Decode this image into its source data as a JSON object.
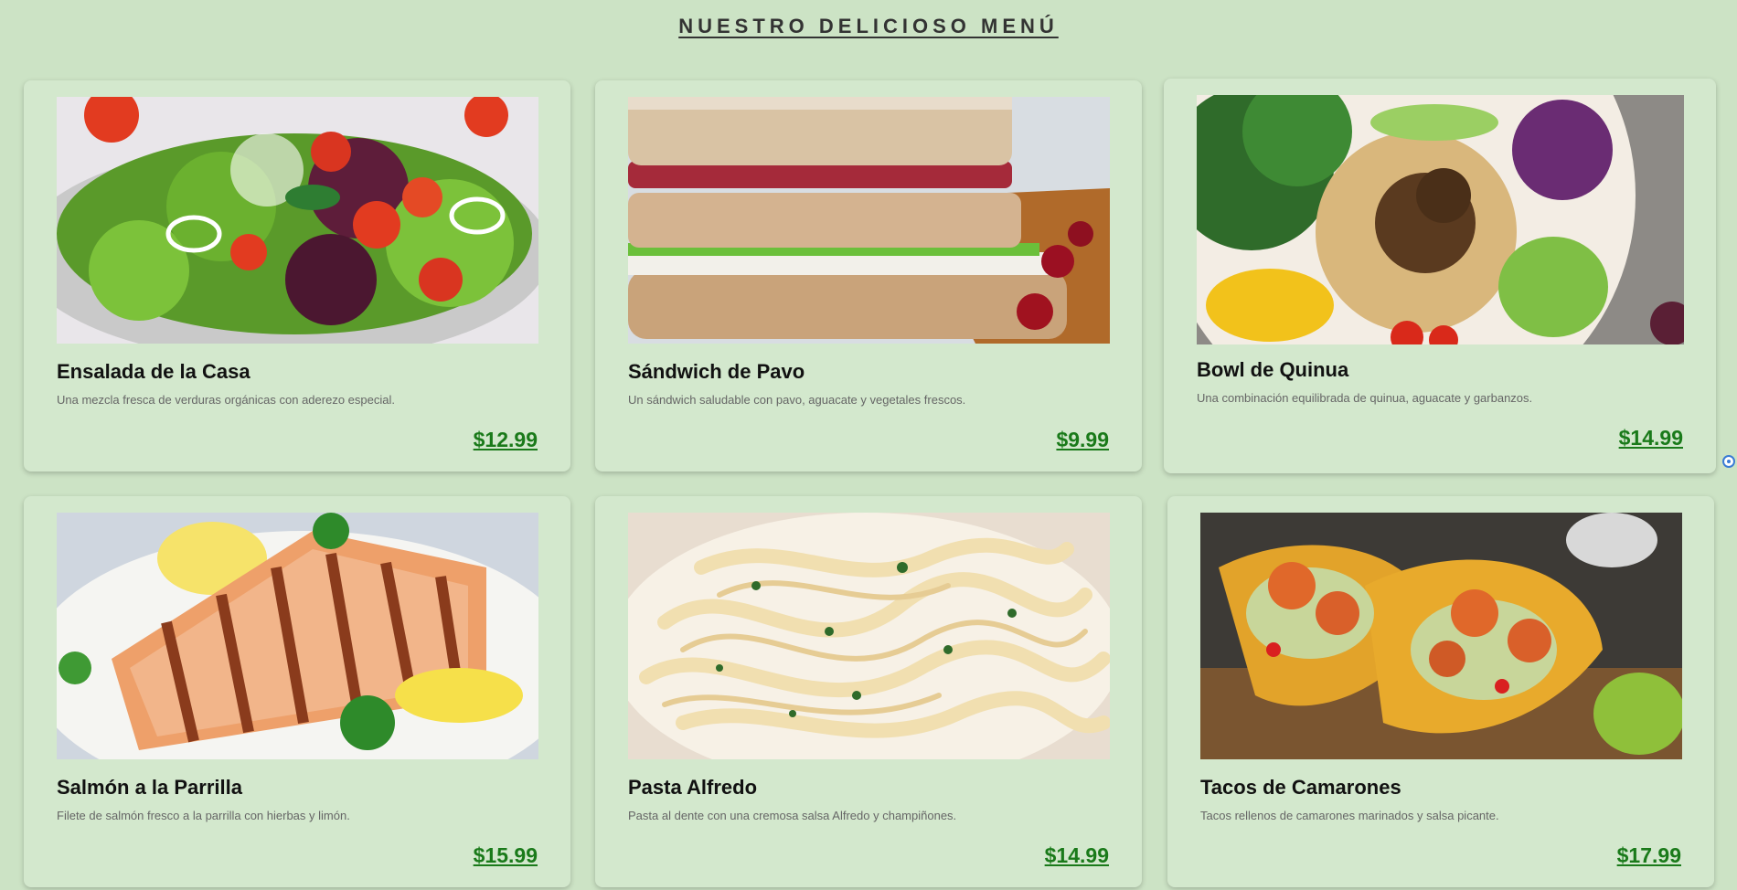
{
  "header": {
    "title": "NUESTRO DELICIOSO MENÚ"
  },
  "menu": {
    "items": [
      {
        "name": "Ensalada de la Casa",
        "description": "Una mezcla fresca de verduras orgánicas con aderezo especial.",
        "price": "$12.99",
        "image_alt": "salad-image"
      },
      {
        "name": "Sándwich de Pavo",
        "description": "Un sándwich saludable con pavo, aguacate y vegetales frescos.",
        "price": "$9.99",
        "image_alt": "sandwich-image"
      },
      {
        "name": "Bowl de Quinua",
        "description": "Una combinación equilibrada de quinua, aguacate y garbanzos.",
        "price": "$14.99",
        "image_alt": "quinoa-bowl-image"
      },
      {
        "name": "Salmón a la Parrilla",
        "description": "Filete de salmón fresco a la parrilla con hierbas y limón.",
        "price": "$15.99",
        "image_alt": "salmon-image"
      },
      {
        "name": "Pasta Alfredo",
        "description": "Pasta al dente con una cremosa salsa Alfredo y champiñones.",
        "price": "$14.99",
        "image_alt": "pasta-image"
      },
      {
        "name": "Tacos de Camarones",
        "description": "Tacos rellenos de camarones marinados y salsa picante.",
        "price": "$17.99",
        "image_alt": "tacos-image"
      }
    ]
  },
  "colors": {
    "background": "#cce3c5",
    "card": "#d3e8cd",
    "price": "#1a7a1a",
    "title": "#333333"
  }
}
